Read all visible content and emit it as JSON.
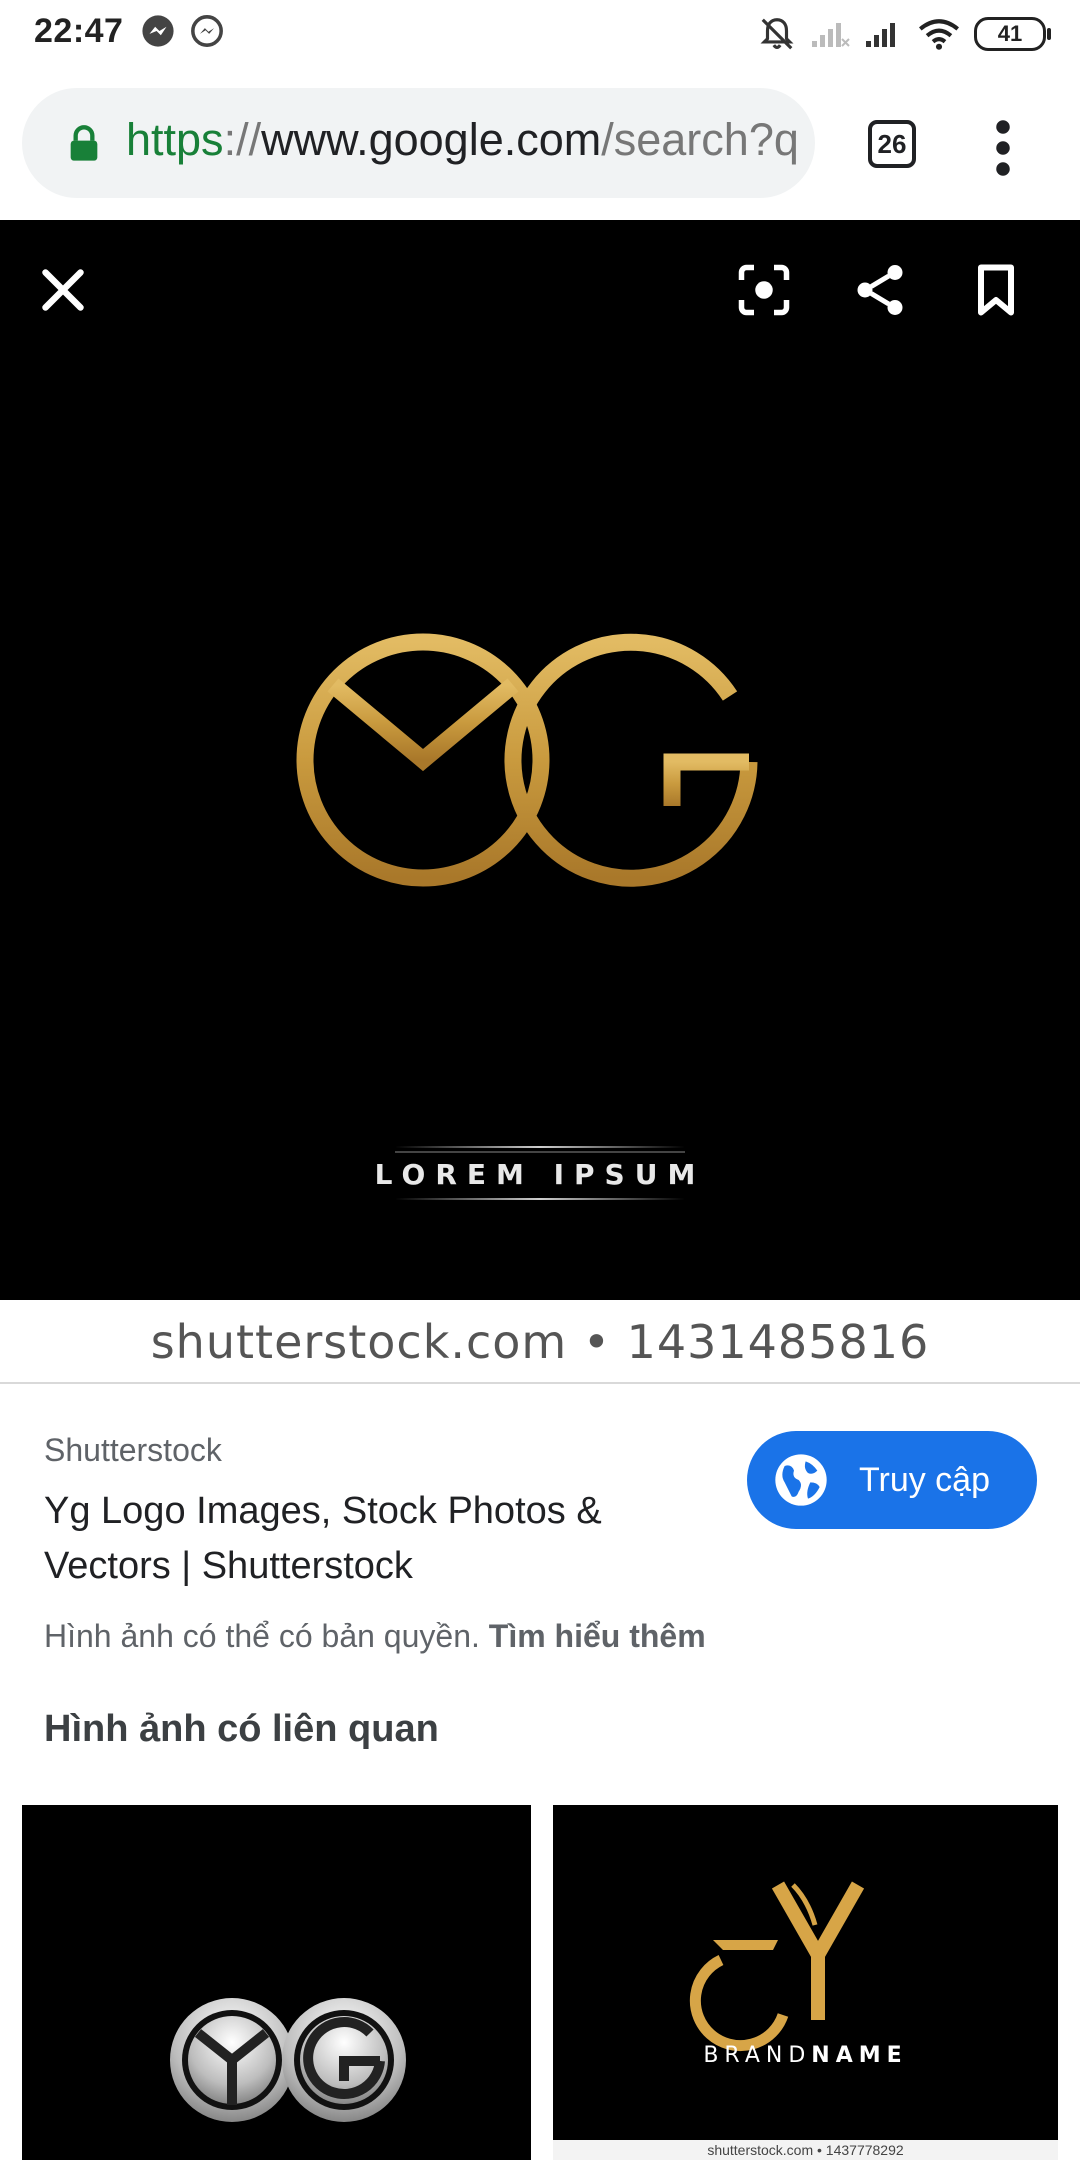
{
  "status_bar": {
    "time": "22:47",
    "battery": "41"
  },
  "browser": {
    "url_scheme": "https",
    "url_sep": "://",
    "url_host": "www.google.com",
    "url_path": "/search?q",
    "tab_count": "26"
  },
  "viewer": {
    "image_caption": "LOREM IPSUM",
    "watermark": "shutterstock.com • 1431485816",
    "colors": {
      "gold": "#c99a3e",
      "background": "#000000"
    }
  },
  "result": {
    "source": "Shutterstock",
    "title": "Yg Logo Images, Stock Photos & Vectors | Shutterstock",
    "visit_label": "Truy cập",
    "copyright_text": "Hình ảnh có thể có bản quyền.",
    "learn_more": "Tìm hiểu thêm"
  },
  "related": {
    "heading": "Hình ảnh có liên quan",
    "items": [
      {
        "caption": ""
      },
      {
        "brand_light": "BRAND",
        "brand_bold": "NAME",
        "caption": "shutterstock.com • 1437778292"
      }
    ]
  }
}
